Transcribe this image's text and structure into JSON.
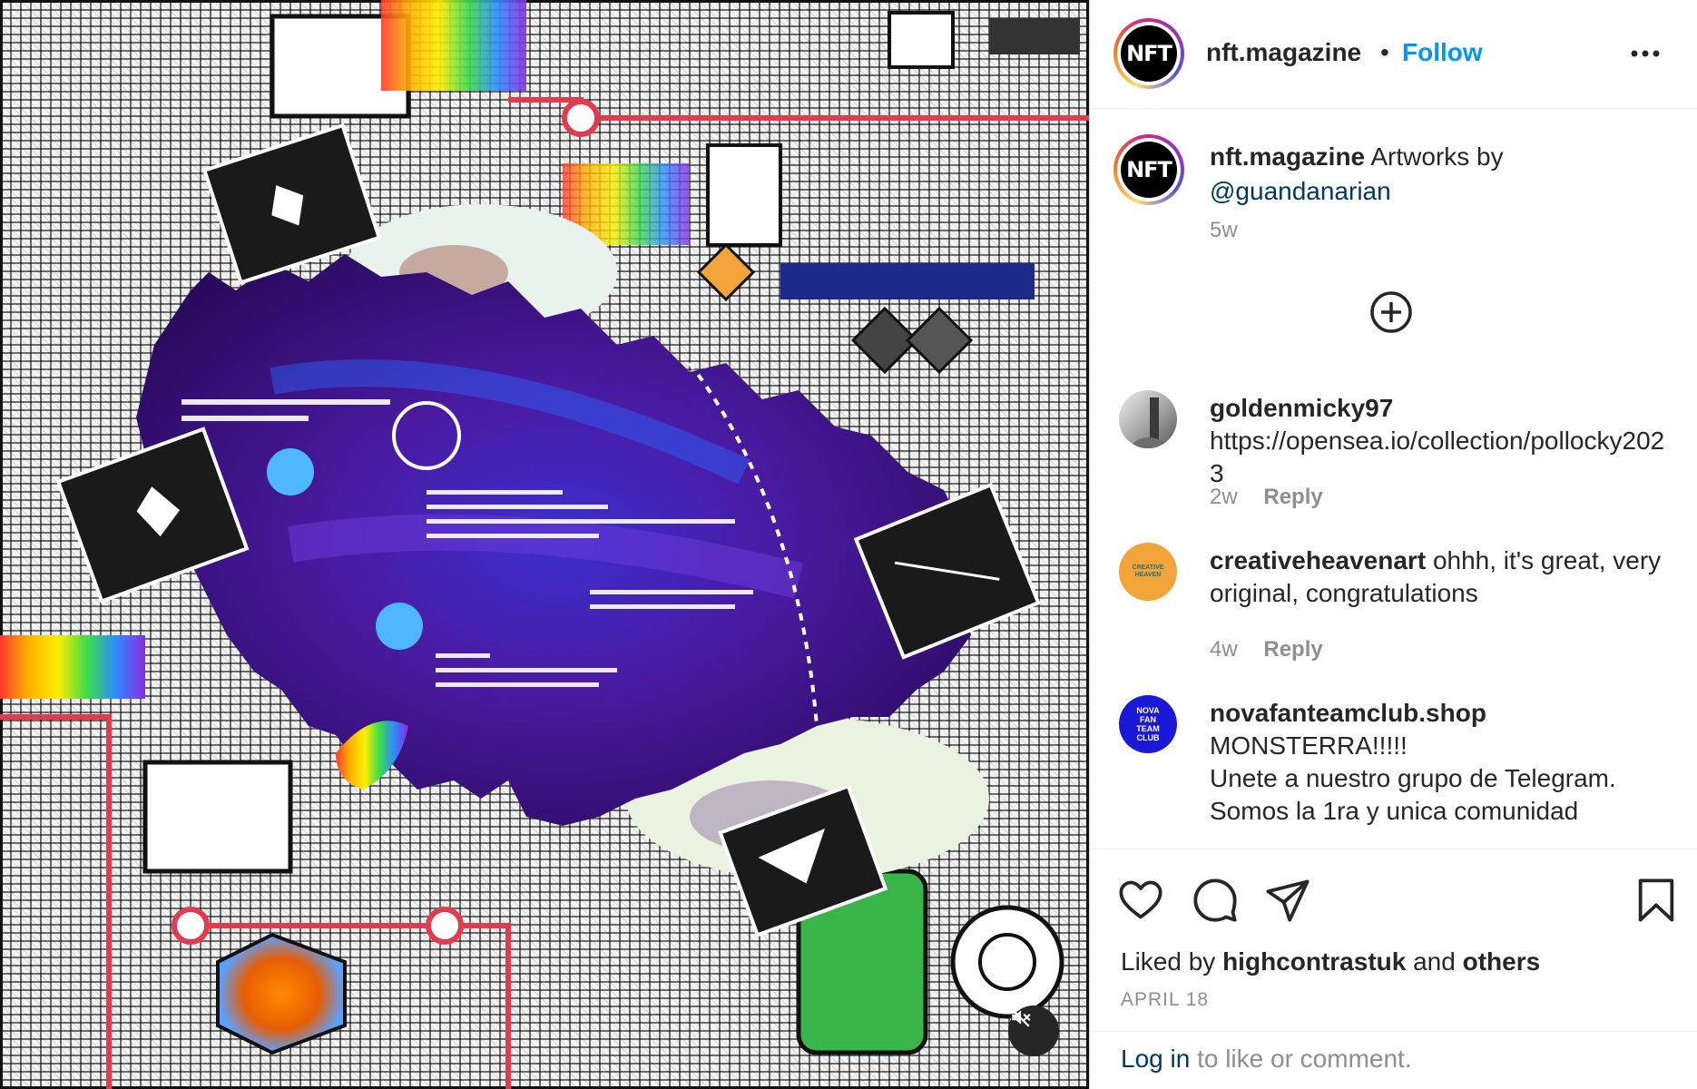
{
  "post": {
    "author": "nft.magazine",
    "avatar_text": "NFT",
    "follow_label": "Follow",
    "separator": "•"
  },
  "caption": {
    "author": "nft.magazine",
    "text": "Artworks by",
    "mention": "@guandanarian",
    "time": "5w"
  },
  "comments": [
    {
      "username": "goldenmicky97",
      "text": "https://opensea.io/collection/pollocky2023",
      "time": "2w",
      "reply_label": "Reply"
    },
    {
      "username": "creativeheavenart",
      "text": "ohhh, it's great, very original, congratulations",
      "time": "4w",
      "reply_label": "Reply",
      "avatar_text": "CREATIVE HEAVEN"
    },
    {
      "username": "novafanteamclub.shop",
      "line1": "MONSTERRA!!!!!",
      "line2": "Unete a nuestro grupo de Telegram.",
      "line3": "Somos la 1ra y unica comunidad",
      "avatar_text": "NOVA FAN TEAM CLUB"
    }
  ],
  "footer": {
    "liked_prefix": "Liked by",
    "liked_user": "highcontrastuk",
    "liked_and": "and",
    "liked_others": "others",
    "date": "APRIL 18",
    "login_link": "Log in",
    "login_suffix": "to like or comment."
  },
  "icons": {
    "like": "heart-icon",
    "comment": "comment-bubble-icon",
    "share": "paper-plane-icon",
    "save": "bookmark-icon",
    "more": "more-horizontal-icon",
    "load_more": "plus-circle-icon",
    "mute": "speaker-muted-icon"
  },
  "colors": {
    "link_blue": "#0095f6",
    "mention_blue": "#00376b",
    "secondary_text": "#8e8e8e",
    "primary_text": "#262626"
  }
}
